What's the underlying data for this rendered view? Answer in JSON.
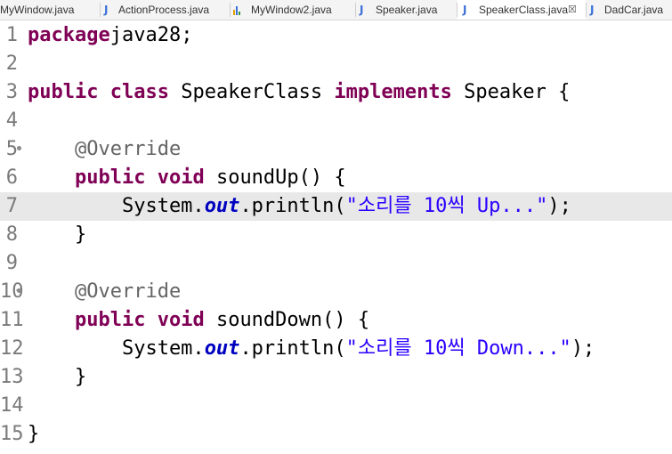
{
  "tabs": [
    {
      "label": "MyWindow.java",
      "icon": "java-file-icon"
    },
    {
      "label": "ActionProcess.java",
      "icon": "java-file-icon"
    },
    {
      "label": "MyWindow2.java",
      "icon": "java-class-warning-icon"
    },
    {
      "label": "Speaker.java",
      "icon": "java-file-icon"
    },
    {
      "label": "SpeakerClass.java",
      "icon": "java-file-icon",
      "active": true,
      "close": "☒"
    },
    {
      "label": "DadCar.java",
      "icon": "java-file-icon"
    }
  ],
  "editor": {
    "current_line": 7,
    "lines": [
      {
        "num": "1",
        "tokens": [
          [
            "kw",
            "package"
          ],
          [
            "",
            "java28;"
          ]
        ]
      },
      {
        "num": "2",
        "tokens": []
      },
      {
        "num": "3",
        "tokens": [
          [
            "kw",
            "public"
          ],
          [
            "",
            " "
          ],
          [
            "kw",
            "class"
          ],
          [
            "",
            " SpeakerClass "
          ],
          [
            "kw",
            "implements"
          ],
          [
            "",
            " Speaker {"
          ]
        ]
      },
      {
        "num": "4",
        "tokens": []
      },
      {
        "num": "5",
        "fold": true,
        "tokens": [
          [
            "",
            "    "
          ],
          [
            "ann",
            "@Override"
          ]
        ]
      },
      {
        "num": "6",
        "tokens": [
          [
            "",
            "    "
          ],
          [
            "kw",
            "public"
          ],
          [
            "",
            " "
          ],
          [
            "kw",
            "void"
          ],
          [
            "",
            " soundUp() {"
          ]
        ]
      },
      {
        "num": "7",
        "tokens": [
          [
            "",
            "        System."
          ],
          [
            "fld",
            "out"
          ],
          [
            "",
            ".println("
          ],
          [
            "str",
            "\"소리를 10씩 Up...\""
          ],
          [
            "",
            ");"
          ]
        ]
      },
      {
        "num": "8",
        "tokens": [
          [
            "",
            "    }"
          ]
        ]
      },
      {
        "num": "9",
        "tokens": []
      },
      {
        "num": "10",
        "fold": true,
        "tokens": [
          [
            "",
            "    "
          ],
          [
            "ann",
            "@Override"
          ]
        ]
      },
      {
        "num": "11",
        "tokens": [
          [
            "",
            "    "
          ],
          [
            "kw",
            "public"
          ],
          [
            "",
            " "
          ],
          [
            "kw",
            "void"
          ],
          [
            "",
            " soundDown() {"
          ]
        ]
      },
      {
        "num": "12",
        "tokens": [
          [
            "",
            "        System."
          ],
          [
            "fld",
            "out"
          ],
          [
            "",
            ".println("
          ],
          [
            "str",
            "\"소리를 10씩 Down...\""
          ],
          [
            "",
            ");"
          ]
        ]
      },
      {
        "num": "13",
        "tokens": [
          [
            "",
            "    }"
          ]
        ]
      },
      {
        "num": "14",
        "tokens": []
      },
      {
        "num": "15",
        "tokens": [
          [
            "",
            "}"
          ]
        ]
      }
    ]
  },
  "colors": {
    "keyword": "#7f0055",
    "annotation": "#646464",
    "field": "#0000c0",
    "string": "#2a00ff",
    "current_line": "#e8e8e8",
    "java_icon": "#3a6fd8"
  }
}
